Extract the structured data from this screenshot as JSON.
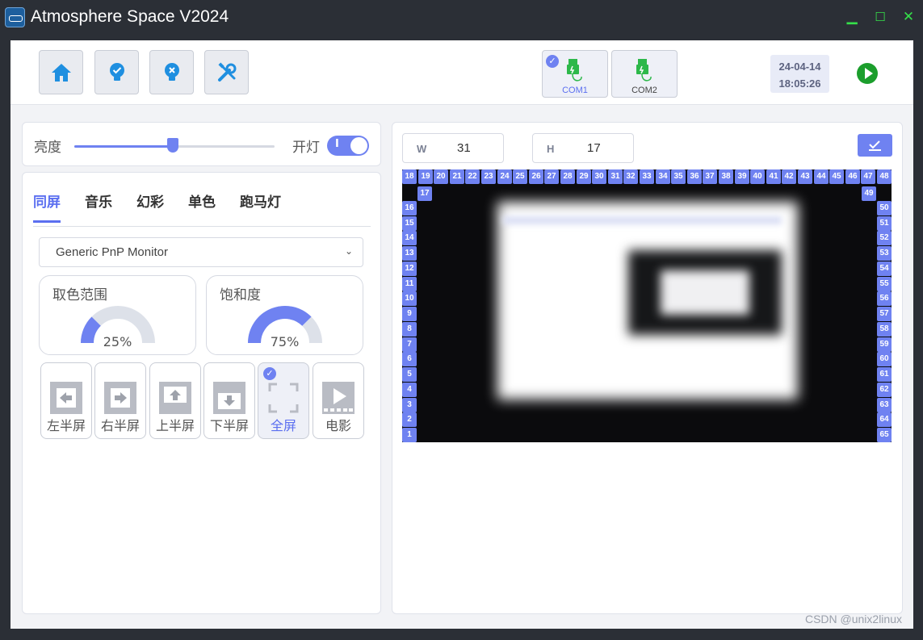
{
  "app": {
    "title": "Atmosphere Space V2024",
    "minimize": "▁",
    "maximize": "☐",
    "close": "✕"
  },
  "toolbar": {
    "buttons": [
      "home-icon",
      "light-on-icon",
      "light-off-icon",
      "tools-icon"
    ],
    "ports": [
      {
        "label": "COM1",
        "selected": true,
        "color": "#5b6ff0"
      },
      {
        "label": "COM2",
        "selected": false,
        "color": "#444444"
      }
    ],
    "date": "24-04-14",
    "time": "18:05:26"
  },
  "brightness": {
    "label": "亮度",
    "value": 0.49,
    "lamp_label": "开灯",
    "lamp_on": true,
    "toggle_mark": "I"
  },
  "tabs": [
    {
      "label": "同屏",
      "active": true
    },
    {
      "label": "音乐",
      "active": false
    },
    {
      "label": "幻彩",
      "active": false
    },
    {
      "label": "单色",
      "active": false
    },
    {
      "label": "跑马灯",
      "active": false
    }
  ],
  "monitor": {
    "selected": "Generic PnP Monitor"
  },
  "gauges": [
    {
      "title": "取色范围",
      "value": 25,
      "display": "25%"
    },
    {
      "title": "饱和度",
      "value": 75,
      "display": "75%"
    }
  ],
  "modes": [
    {
      "label": "左半屏",
      "icon": "left-half-icon",
      "active": false
    },
    {
      "label": "右半屏",
      "icon": "right-half-icon",
      "active": false
    },
    {
      "label": "上半屏",
      "icon": "top-half-icon",
      "active": false
    },
    {
      "label": "下半屏",
      "icon": "bottom-half-icon",
      "active": false
    },
    {
      "label": "全屏",
      "icon": "fullscreen-icon",
      "active": true
    },
    {
      "label": "电影",
      "icon": "movie-icon",
      "active": false
    }
  ],
  "dimensions": {
    "w_label": "W",
    "w_value": "31",
    "h_label": "H",
    "h_value": "17"
  },
  "leds": {
    "top": [
      18,
      19,
      20,
      21,
      22,
      23,
      24,
      25,
      26,
      27,
      28,
      29,
      30,
      31,
      32,
      33,
      34,
      35,
      36,
      37,
      38,
      39,
      40,
      41,
      42,
      43,
      44,
      45,
      46,
      47,
      48
    ],
    "left": [
      17,
      16,
      15,
      14,
      13,
      12,
      11,
      10,
      9,
      8,
      7,
      6,
      5,
      4,
      3,
      2,
      1
    ],
    "right": [
      49,
      50,
      51,
      52,
      53,
      54,
      55,
      56,
      57,
      58,
      59,
      60,
      61,
      62,
      63,
      64,
      65
    ]
  },
  "colors": {
    "accent": "#6f82f1",
    "titlebar": "#2b2f36",
    "window_buttons": "#35e04a",
    "play": "#1b9e2c"
  },
  "watermark": "CSDN @unix2linux"
}
